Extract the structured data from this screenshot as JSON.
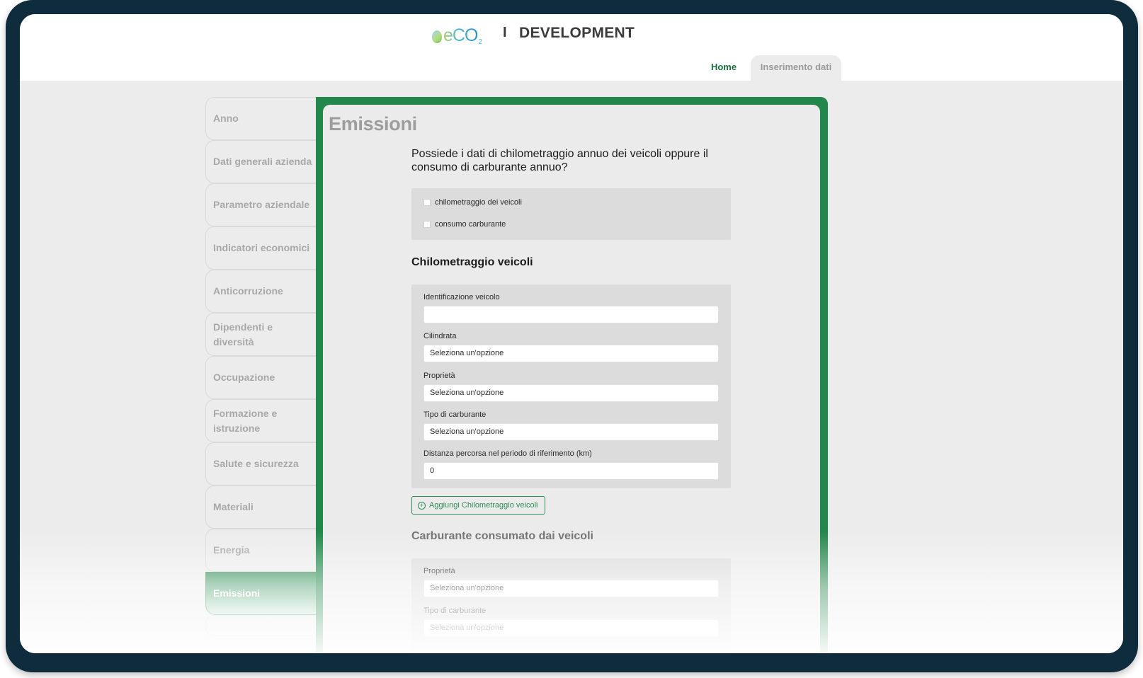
{
  "header": {
    "logo_text": "eCO",
    "logo_subscript": "2",
    "separator": "I",
    "environment": "DEVELOPMENT"
  },
  "nav": {
    "home": "Home",
    "data_entry": "Inserimento dati"
  },
  "sidebar": {
    "items": [
      {
        "label": "Anno"
      },
      {
        "label": "Dati generali azienda"
      },
      {
        "label": "Parametro aziendale"
      },
      {
        "label": "Indicatori economici"
      },
      {
        "label": "Anticorruzione"
      },
      {
        "label": "Dipendenti e diversità"
      },
      {
        "label": "Occupazione"
      },
      {
        "label": "Formazione e istruzione"
      },
      {
        "label": "Salute e sicurezza"
      },
      {
        "label": "Materiali"
      },
      {
        "label": "Energia"
      },
      {
        "label": "Emissioni"
      }
    ],
    "active": "Emissioni"
  },
  "main": {
    "title": "Emissioni",
    "question": "Possiede i dati di chilometraggio annuo dei veicoli oppure il consumo di carburante annuo?",
    "options": [
      "chilometraggio dei veicoli",
      "consumo carburante"
    ],
    "section1": {
      "title": "Chilometraggio veicoli",
      "fields": {
        "vehicle_id_label": "Identificazione veicolo",
        "vehicle_id_value": "",
        "displacement_label": "Cilindrata",
        "displacement_value": "Seleziona un'opzione",
        "ownership_label": "Proprietà",
        "ownership_value": "Seleziona un'opzione",
        "fuel_type_label": "Tipo di carburante",
        "fuel_type_value": "Seleziona un'opzione",
        "distance_label": "Distanza percorsa nel periodo di riferimento (km)",
        "distance_value": "0"
      },
      "add_button": "Aggiungi Chilometraggio veicoli"
    },
    "section2": {
      "title": "Carburante consumato dai veicoli",
      "fields": {
        "ownership_label": "Proprietà",
        "ownership_value": "Seleziona un'opzione",
        "fuel_type_label": "Tipo di carburante",
        "fuel_type_value": "Seleziona un'opzione"
      }
    }
  },
  "colors": {
    "brand_green": "#21874b",
    "frame": "#0f2c3d",
    "background": "#ececec"
  }
}
